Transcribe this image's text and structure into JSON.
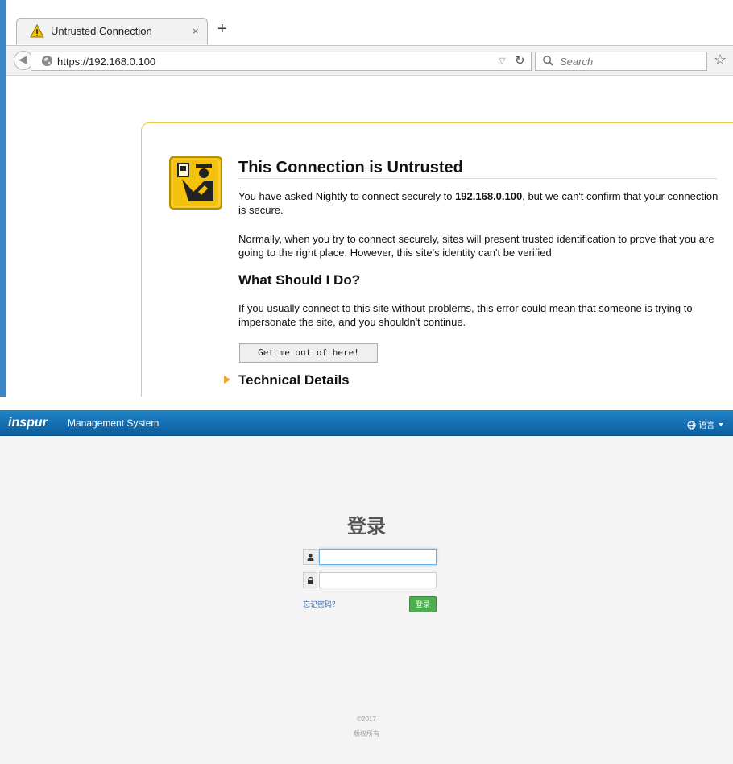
{
  "browser": {
    "tab": {
      "title": "Untrusted Connection",
      "close": "×",
      "new_tab": "+"
    },
    "url": "https://192.168.0.100",
    "search_placeholder": "Search",
    "icons": [
      "warning-icon",
      "back-icon",
      "globe-icon",
      "dropdown-icon",
      "reload-icon",
      "search-icon",
      "bookmark-star-icon"
    ]
  },
  "error": {
    "title": "This Connection is Untrusted",
    "p1_before": "You have asked Nightly to connect securely to ",
    "p1_host": "192.168.0.100",
    "p1_after": ", but we can't confirm that your connection is secure.",
    "p2": "Normally, when you try to connect securely, sites will present trusted identification to prove that you are going to the right place. However, this site's identity can't be verified.",
    "what_heading": "What Should I Do?",
    "p3": "If you usually connect to this site without problems, this error could mean that someone is trying to impersonate the site, and you shouldn't continue.",
    "get_out_button": "Get me out of here!",
    "technical_details": "Technical Details"
  },
  "app": {
    "brand": "inspur",
    "title": "Management System",
    "language": "语言",
    "login_title": "登录",
    "username_value": "",
    "password_value": "",
    "forgot_password": "忘记密码？",
    "login_button": "登录",
    "footer_year": "©2017",
    "footer_rights": "版权所有",
    "colors": {
      "header": "#1a76bb",
      "login_button": "#4cae4c",
      "link": "#2a6db0"
    }
  }
}
